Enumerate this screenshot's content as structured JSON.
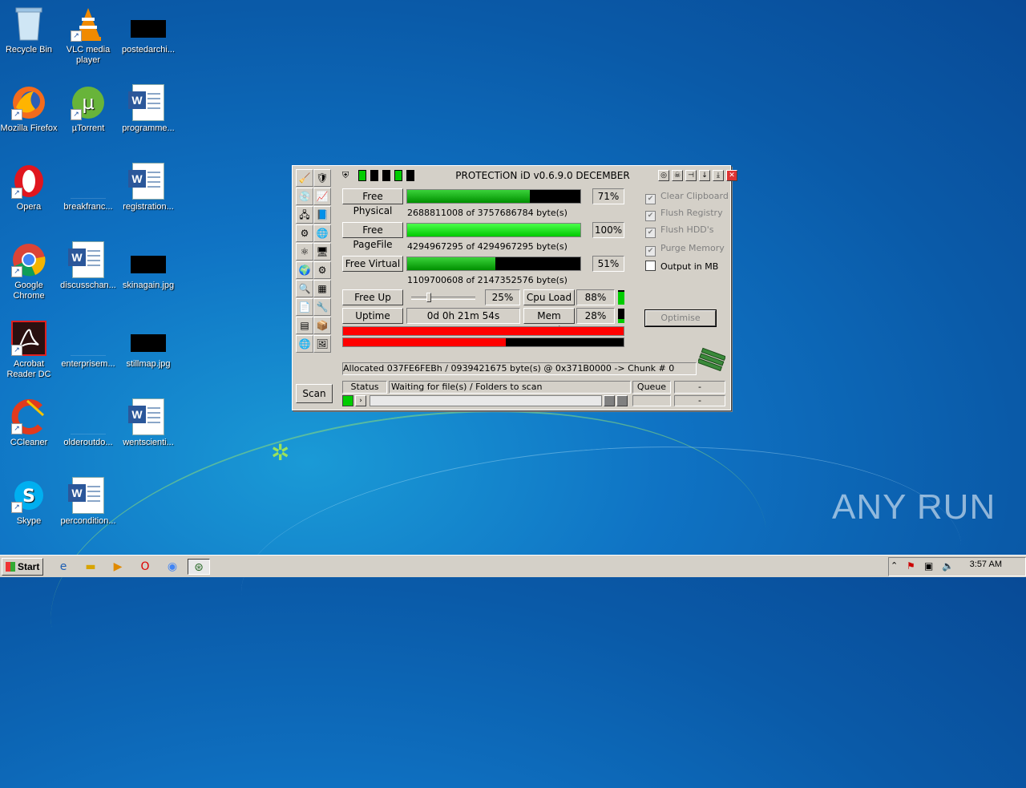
{
  "desktop": {
    "icons": [
      {
        "label": "Recycle Bin"
      },
      {
        "label": "VLC media player"
      },
      {
        "label": "postedarchi..."
      },
      {
        "label": "Mozilla Firefox"
      },
      {
        "label": "µTorrent"
      },
      {
        "label": "programme..."
      },
      {
        "label": "Opera"
      },
      {
        "label": "breakfranc..."
      },
      {
        "label": "registration..."
      },
      {
        "label": "Google Chrome"
      },
      {
        "label": "discusschan..."
      },
      {
        "label": "skinagain.jpg"
      },
      {
        "label": "Acrobat Reader DC"
      },
      {
        "label": "enterprisem..."
      },
      {
        "label": "stillmap.jpg"
      },
      {
        "label": "CCleaner"
      },
      {
        "label": "olderoutdo..."
      },
      {
        "label": "wentscienti..."
      },
      {
        "label": "Skype"
      },
      {
        "label": "percondition..."
      }
    ]
  },
  "window": {
    "title": "PROTECTiON iD v0.6.9.0 DECEMBER",
    "memory": {
      "physical": {
        "label": "Free Physical",
        "percent_text": "71%",
        "fraction": 0.71,
        "bytes": "2688811008 of 3757686784 byte(s)"
      },
      "pagefile": {
        "label": "Free PageFile",
        "percent_text": "100%",
        "fraction": 1.0,
        "bytes": "4294967295 of 4294967295 byte(s)"
      },
      "virtual": {
        "label": "Free Virtual",
        "percent_text": "51%",
        "fraction": 0.51,
        "bytes": "1109700608 of 2147352576 byte(s)"
      }
    },
    "freeup": {
      "label": "Free Up",
      "value_text": "25%",
      "slider_fraction": 0.25
    },
    "cpu": {
      "label": "Cpu Load",
      "value_text": "88%"
    },
    "uptime": {
      "label": "Uptime",
      "value": "0d 0h 21m 54s"
    },
    "mem": {
      "label": "Mem Load",
      "value_text": "28%"
    },
    "red_bars": [
      1.0,
      0.58
    ],
    "options": [
      {
        "label": "Clear Clipboard",
        "checked": true,
        "enabled": false
      },
      {
        "label": "Flush Registry",
        "checked": true,
        "enabled": false
      },
      {
        "label": "Flush HDD's",
        "checked": true,
        "enabled": false
      },
      {
        "label": "Purge Memory",
        "checked": true,
        "enabled": false
      },
      {
        "label": "Output in MB",
        "checked": false,
        "enabled": true
      }
    ],
    "optimise_label": "Optimise",
    "allocated": "Allocated 037FE6FEBh / 0939421675 byte(s) @ 0x371B0000 -> Chunk # 0",
    "scan_label": "Scan",
    "status_label": "Status",
    "status_text": "Waiting for file(s) / Folders to scan",
    "queue_label": "Queue",
    "queue_value": "-",
    "queue_value2": "-"
  },
  "taskbar": {
    "start_label": "Start",
    "clock": "3:57 AM"
  },
  "watermark": "ANY RUN"
}
